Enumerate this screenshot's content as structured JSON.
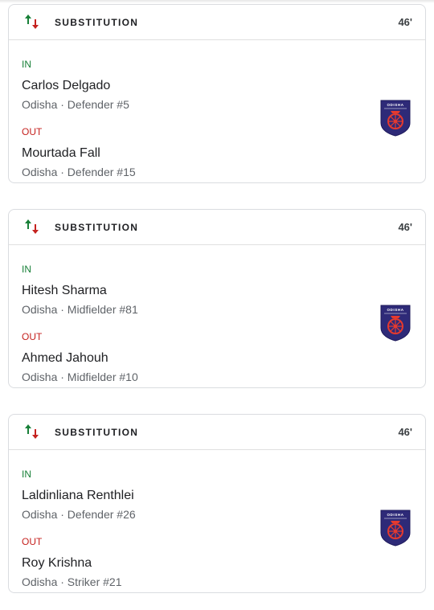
{
  "substitutions": [
    {
      "title": "SUBSTITUTION",
      "minute": "46'",
      "in_label": "IN",
      "out_label": "OUT",
      "player_in": {
        "name": "Carlos Delgado",
        "info": "Odisha · Defender #5"
      },
      "player_out": {
        "name": "Mourtada Fall",
        "info": "Odisha · Defender #15"
      },
      "crest_text": "ODISHA"
    },
    {
      "title": "SUBSTITUTION",
      "minute": "46'",
      "in_label": "IN",
      "out_label": "OUT",
      "player_in": {
        "name": "Hitesh Sharma",
        "info": "Odisha · Midfielder #81"
      },
      "player_out": {
        "name": "Ahmed Jahouh",
        "info": "Odisha · Midfielder #10"
      },
      "crest_text": "ODISHA"
    },
    {
      "title": "SUBSTITUTION",
      "minute": "46'",
      "in_label": "IN",
      "out_label": "OUT",
      "player_in": {
        "name": "Laldinliana Renthlei",
        "info": "Odisha · Defender #26"
      },
      "player_out": {
        "name": "Roy Krishna",
        "info": "Odisha · Striker #21"
      },
      "crest_text": "ODISHA"
    }
  ],
  "icons": {
    "substitution": "substitution-arrows-icon",
    "crest": "odisha-fc-crest"
  },
  "colors": {
    "in": "#188038",
    "out": "#c5221f",
    "crest_navy": "#2e2a78",
    "crest_red": "#e63a2e"
  }
}
